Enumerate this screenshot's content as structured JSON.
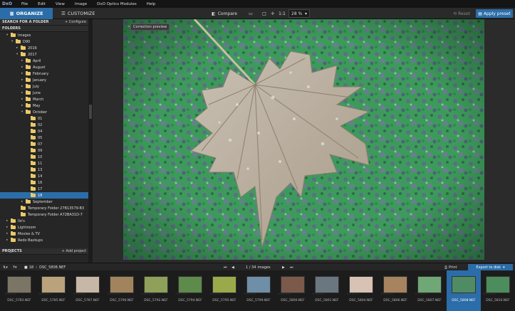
{
  "app": {
    "logo": "DxO"
  },
  "menu": [
    "File",
    "Edit",
    "View",
    "Image",
    "DxO Optics Modules",
    "Help"
  ],
  "tabs": {
    "organize": "ORGANIZE",
    "customize": "CUSTOMIZE"
  },
  "toolbar": {
    "compare": "Compare",
    "one_to_one": "1:1",
    "zoom": "28 %",
    "reset": "Reset",
    "apply_preset": "Apply preset"
  },
  "sidebar": {
    "search_title": "SEARCH FOR A FOLDER",
    "configure": "+ Configure",
    "folders_title": "FOLDERS",
    "projects_title": "PROJECTS",
    "add_project": "+ Add project"
  },
  "tree": [
    {
      "label": "Images",
      "depth": 2,
      "open": true
    },
    {
      "label": "D90",
      "depth": 3,
      "open": true
    },
    {
      "label": "2016",
      "depth": 4,
      "open": false
    },
    {
      "label": "2017",
      "depth": 4,
      "open": true
    },
    {
      "label": "April",
      "depth": 5,
      "open": false
    },
    {
      "label": "August",
      "depth": 5,
      "open": false
    },
    {
      "label": "February",
      "depth": 5,
      "open": false
    },
    {
      "label": "January",
      "depth": 5,
      "open": false
    },
    {
      "label": "July",
      "depth": 5,
      "open": false
    },
    {
      "label": "June",
      "depth": 5,
      "open": false
    },
    {
      "label": "March",
      "depth": 5,
      "open": false
    },
    {
      "label": "May",
      "depth": 5,
      "open": false
    },
    {
      "label": "October",
      "depth": 5,
      "open": true
    },
    {
      "label": "01",
      "depth": 6
    },
    {
      "label": "02",
      "depth": 6
    },
    {
      "label": "04",
      "depth": 6
    },
    {
      "label": "05",
      "depth": 6
    },
    {
      "label": "07",
      "depth": 6
    },
    {
      "label": "09",
      "depth": 6
    },
    {
      "label": "10",
      "depth": 6
    },
    {
      "label": "11",
      "depth": 6
    },
    {
      "label": "13",
      "depth": 6
    },
    {
      "label": "14",
      "depth": 6
    },
    {
      "label": "16",
      "depth": 6
    },
    {
      "label": "17",
      "depth": 6
    },
    {
      "label": "18",
      "depth": 6,
      "selected": true
    },
    {
      "label": "September",
      "depth": 5,
      "open": false
    },
    {
      "label": "Temporary Folder 27B13579-B3",
      "depth": 4
    },
    {
      "label": "Temporary Folder A72BA31D-7",
      "depth": 4
    },
    {
      "label": "Ilo's",
      "depth": 2,
      "open": false
    },
    {
      "label": "Lightroom",
      "depth": 2,
      "open": false
    },
    {
      "label": "Movies & TV",
      "depth": 2,
      "open": false
    },
    {
      "label": "Redo Backups",
      "depth": 2,
      "open": false
    }
  ],
  "viewer": {
    "correction_preview": "Correction preview"
  },
  "navbar": {
    "folder": "18",
    "file": "DSC_5808.NEF",
    "counter": "1 / 34",
    "counter_suffix": "images",
    "print": "Print",
    "export": "Export to disk"
  },
  "thumbnails": [
    {
      "name": "DSC_5783.NEF",
      "color": "#7a7565"
    },
    {
      "name": "DSC_5785.NEF",
      "color": "#b9a27c"
    },
    {
      "name": "DSC_5787.NEF",
      "color": "#c7b7a6"
    },
    {
      "name": "DSC_5790.NEF",
      "color": "#a1845e"
    },
    {
      "name": "DSC_5792.NEF",
      "color": "#8fa05a"
    },
    {
      "name": "DSC_5794.NEF",
      "color": "#5e8a4b"
    },
    {
      "name": "DSC_5795.NEF",
      "color": "#9aaa4a"
    },
    {
      "name": "DSC_5799.NEF",
      "color": "#6e8fa7"
    },
    {
      "name": "DSC_5800.NEF",
      "color": "#7b5a4c"
    },
    {
      "name": "DSC_5801.NEF",
      "color": "#6a7781"
    },
    {
      "name": "DSC_5804.NEF",
      "color": "#d7c2b4"
    },
    {
      "name": "DSC_5806.NEF",
      "color": "#a7835f"
    },
    {
      "name": "DSC_5807.NEF",
      "color": "#6fa876"
    },
    {
      "name": "DSC_5808.NEF",
      "color": "#4f8c63",
      "selected": true
    },
    {
      "name": "DSC_5810.NEF",
      "color": "#4d8c5c"
    }
  ],
  "colors": {
    "accent": "#2b6da8",
    "panel": "#262626",
    "folder": "#e9c86a"
  }
}
